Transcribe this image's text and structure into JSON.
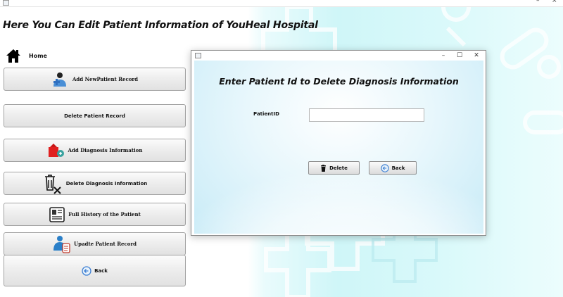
{
  "window": {
    "title_controls": {
      "minimize": "–",
      "close": "×"
    }
  },
  "page": {
    "title": "Here You Can Edit Patient Information of YouHeal Hospital"
  },
  "sidebar": {
    "home_label": "Home",
    "buttons": [
      {
        "label": "Add NewPatient Record",
        "icon": "add-patient-icon"
      },
      {
        "label": "Delete Patient Record",
        "icon": ""
      },
      {
        "label": "Add Diagnosis Information",
        "icon": "add-diagnosis-icon"
      },
      {
        "label": "Delete Diagnosis Information",
        "icon": "delete-bin-icon"
      },
      {
        "label": "Full History of the Patient",
        "icon": "patient-card-icon"
      },
      {
        "label": "Upadte Patient Record",
        "icon": "update-patient-icon"
      },
      {
        "label": "Back",
        "icon": "back-arrow-icon"
      }
    ]
  },
  "dialog": {
    "controls": {
      "minimize": "–",
      "maximize": "☐",
      "close": "✕"
    },
    "heading": "Enter Patient Id to Delete Diagnosis Information",
    "field_label": "PatientID",
    "field_value": "",
    "delete_label": "Delete",
    "back_label": "Back"
  },
  "colors": {
    "cyan_background": "#cff6f8",
    "dialog_background": "#c8ebf7",
    "button_gradient_top": "#fcfcfc",
    "button_gradient_bottom": "#e1e1e1"
  }
}
